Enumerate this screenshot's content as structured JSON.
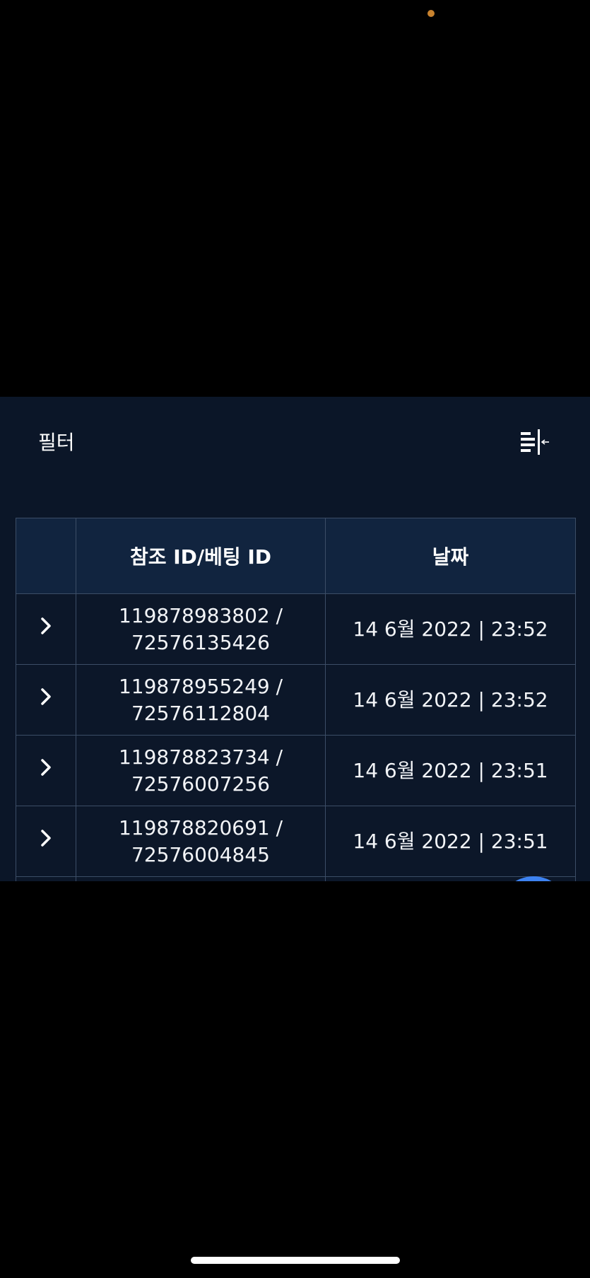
{
  "filter": {
    "label": "필터",
    "toggle_icon": "filter-panel-toggle-icon"
  },
  "table": {
    "columns": [
      "",
      "참조 ID/베팅 ID",
      "날짜"
    ],
    "rows": [
      {
        "ref_id": "119878983802 /",
        "bet_id": "72576135426",
        "date": "14 6월 2022 | 23:52"
      },
      {
        "ref_id": "119878955249 /",
        "bet_id": "72576112804",
        "date": "14 6월 2022 | 23:52"
      },
      {
        "ref_id": "119878823734 /",
        "bet_id": "72576007256",
        "date": "14 6월 2022 | 23:51"
      },
      {
        "ref_id": "119878820691 /",
        "bet_id": "72576004845",
        "date": "14 6월 2022 | 23:51"
      }
    ],
    "expand_icon": "chevron-right-icon"
  },
  "colors": {
    "panel_bg": "#0b1628",
    "header_bg": "#11243f",
    "border": "#3c4d66",
    "accent": "#3d82f0",
    "status_dot": "#c8822e"
  }
}
